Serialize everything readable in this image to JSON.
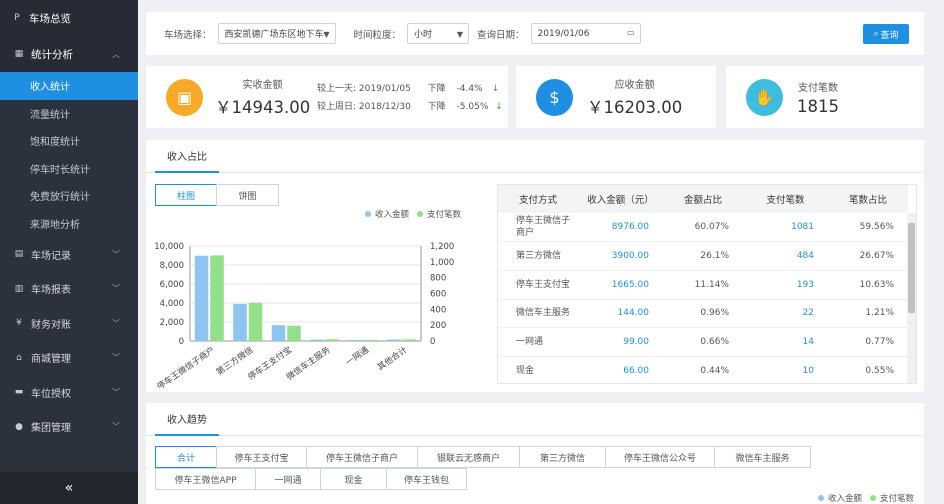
{
  "sidebar": {
    "top": "车场总览",
    "section": "统计分析",
    "items": [
      "收入统计",
      "流量统计",
      "饱和度统计",
      "停车时长统计",
      "免费放行统计",
      "来源地分析"
    ],
    "groups": [
      "车场记录",
      "车场报表",
      "财务对账",
      "商城管理",
      "车位授权",
      "集团管理"
    ],
    "collapse_icon": "«"
  },
  "filter": {
    "lot_label": "车场选择：",
    "lot_value": "西安凯德广场东区地下车库",
    "granularity_label": "时间粒度：",
    "granularity_value": "小时",
    "date_label": "查询日期：",
    "date_value": "2019/01/06",
    "query_button": "查询"
  },
  "stats": {
    "actual": {
      "label": "实收金额",
      "value": "￥14943.00",
      "cmp1_label": "较上一天:",
      "cmp1_date": "2019/01/05",
      "cmp1_dir": "下降",
      "cmp1_pct": "-4.4%",
      "cmp2_label": "较上周日:",
      "cmp2_date": "2018/12/30",
      "cmp2_dir": "下降",
      "cmp2_pct": "-5.05%"
    },
    "due": {
      "label": "应收金额",
      "value": "￥16203.00"
    },
    "count": {
      "label": "支付笔数",
      "value": "1815"
    }
  },
  "share": {
    "tab": "收入占比",
    "toggle": [
      "柱图",
      "饼图"
    ],
    "legend": [
      "收入金额",
      "支付笔数"
    ],
    "table_headers": [
      "支付方式",
      "收入金额（元）",
      "金额占比",
      "支付笔数",
      "笔数占比"
    ],
    "rows": [
      [
        "停车王微信子商户",
        "8976.00",
        "60.07%",
        "1081",
        "59.56%"
      ],
      [
        "第三方微信",
        "3900.00",
        "26.1%",
        "484",
        "26.67%"
      ],
      [
        "停车王支付宝",
        "1665.00",
        "11.14%",
        "193",
        "10.63%"
      ],
      [
        "微信车主服务",
        "144.00",
        "0.96%",
        "22",
        "1.21%"
      ],
      [
        "一网通",
        "99.00",
        "0.66%",
        "14",
        "0.77%"
      ],
      [
        "现金",
        "66.00",
        "0.44%",
        "10",
        "0.55%"
      ]
    ]
  },
  "chart_data": {
    "type": "bar",
    "categories": [
      "停车王微信子商户",
      "第三方微信",
      "停车王支付宝",
      "微信车主服务",
      "一网通",
      "其他合计"
    ],
    "series": [
      {
        "name": "收入金额",
        "values": [
          8976,
          3900,
          1665,
          144,
          99,
          159
        ]
      },
      {
        "name": "支付笔数",
        "values": [
          1081,
          484,
          193,
          22,
          14,
          21
        ]
      }
    ],
    "left_axis": {
      "ylim": [
        0,
        10000
      ],
      "ticks": [
        "0",
        "2,000",
        "4,000",
        "6,000",
        "8,000",
        "10,000"
      ]
    },
    "right_axis": {
      "ylim": [
        0,
        1200
      ],
      "ticks": [
        "0",
        "200",
        "400",
        "600",
        "800",
        "1,000",
        "1,200"
      ]
    },
    "colors": {
      "收入金额": "#8ec4f0",
      "支付笔数": "#93df8a"
    },
    "legend_position": "top-right"
  },
  "trend": {
    "tab": "收入趋势",
    "buttons_row1": [
      "合计",
      "停车王支付宝",
      "停车王微信子商户",
      "银联云无感商户",
      "第三方微信",
      "停车王微信公众号",
      "微信车主服务"
    ],
    "buttons_row2": [
      "停车王微信APP",
      "一网通",
      "现金",
      "停车王钱包"
    ],
    "legend": [
      "收入金额",
      "支付笔数"
    ]
  },
  "colors": {
    "accent": "#1e8fe1",
    "sidebar": "#2b313d",
    "down": "#2ea84a",
    "icon_orange": "#f7a928",
    "icon_blue": "#1e8fe1",
    "icon_cyan": "#3fbde0"
  }
}
